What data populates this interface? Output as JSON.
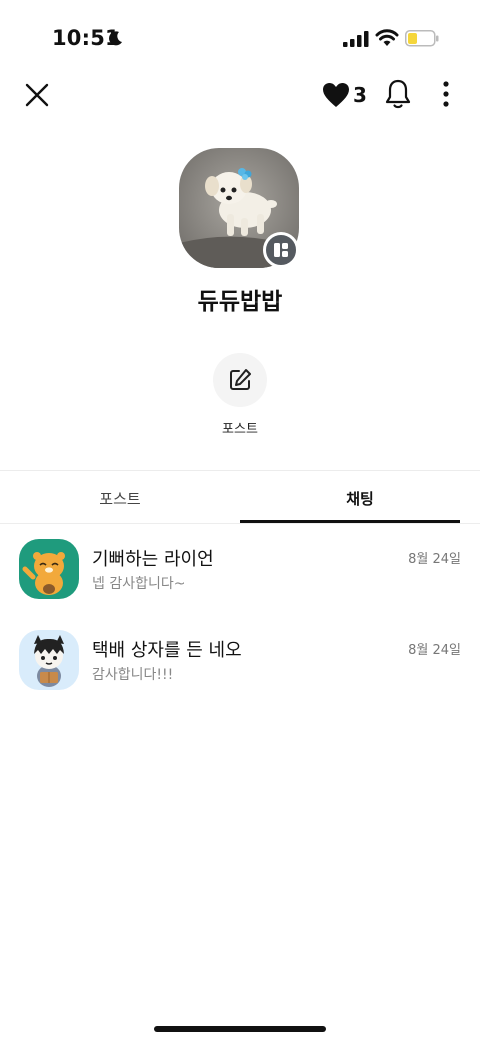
{
  "status_bar": {
    "time": "10:51",
    "icons": [
      "moon-icon",
      "signal-icon",
      "wifi-icon",
      "battery-icon"
    ]
  },
  "top_nav": {
    "close_icon": "close-icon",
    "like_count": "3",
    "bell_icon": "bell-icon",
    "more_icon": "more-vertical-icon"
  },
  "profile": {
    "name": "듀듀밥밥",
    "action_label": "포스트",
    "action_icon": "edit-icon"
  },
  "tabs": [
    {
      "label": "포스트",
      "active": false
    },
    {
      "label": "채팅",
      "active": true
    }
  ],
  "chats": [
    {
      "name": "기뻐하는 라이언",
      "preview": "넵 감사합니다~",
      "date": "8월 24일",
      "avatar_bg": "#1f9b7d"
    },
    {
      "name": "택배 상자를 든 네오",
      "preview": "감사합니다!!!",
      "date": "8월 24일",
      "avatar_bg": "#d9ecfb"
    }
  ],
  "colors": {
    "battery_fill": "#f5d63b",
    "heart": "#111111",
    "badge": "#555a60"
  }
}
